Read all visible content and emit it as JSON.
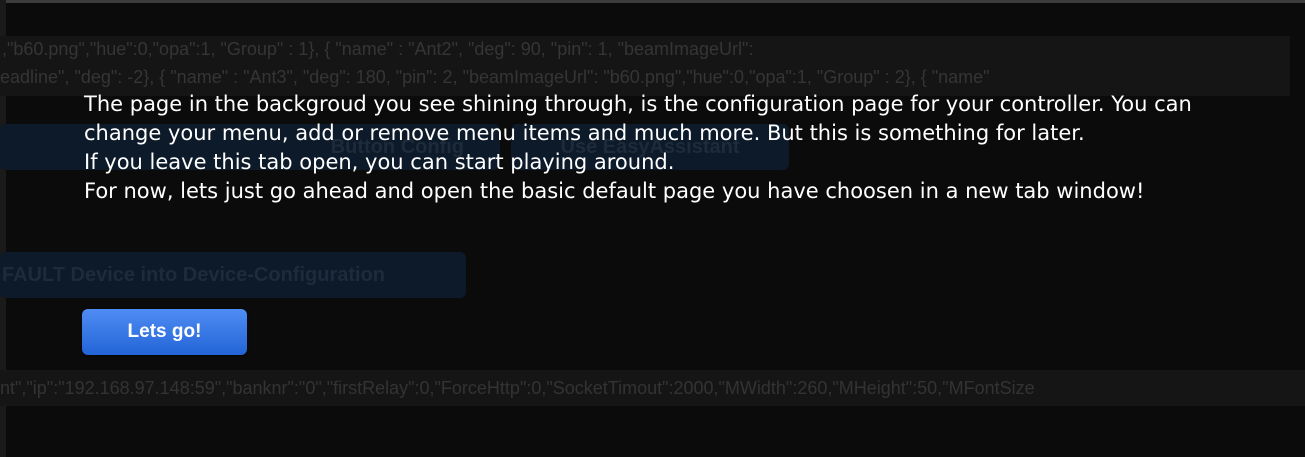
{
  "background": {
    "config_lines": [
      ",\"b60.png\",\"hue\":0,\"opa\":1, \"Group\" : 1}, { \"name\" : \"Ant2\", \"deg\": 90, \"pin\": 1, \"beamImageUrl\":",
      "eadline\", \"deg\": -2}, { \"name\" : \"Ant3\", \"deg\": 180, \"pin\": 2, \"beamImageUrl\": \"b60.png\",\"hue\":0,\"opa\":1, \"Group\" : 2}, { \"name\""
    ],
    "buttons": [
      {
        "label": "Button Config"
      },
      {
        "label": "Use EasyAssistant"
      },
      {
        "label": "FAULT Device into Device-Configuration"
      }
    ],
    "json_line": "nt\",\"ip\":\"192.168.97.148:59\",\"banknr\":\"0\",\"firstRelay\":0,\"ForceHttp\":0,\"SocketTimout\":2000,\"MWidth\":260,\"MHeight\":50,\"MFontSize"
  },
  "overlay": {
    "paragraphs": [
      "The page in the backgroud you see shining through, is the configuration page for your controller. You can change your menu, add or remove menu items and much more. But this is something for later.",
      "If you leave this tab open, you can start playing around.",
      "For now, lets just go ahead and open the basic default page you have choosen in a new tab window!"
    ],
    "button_label": "Lets go!"
  },
  "colors": {
    "overlay_background": "#000000",
    "text": "#ffffff",
    "button_top": "#4f8df4",
    "button_bottom": "#2364d6"
  }
}
